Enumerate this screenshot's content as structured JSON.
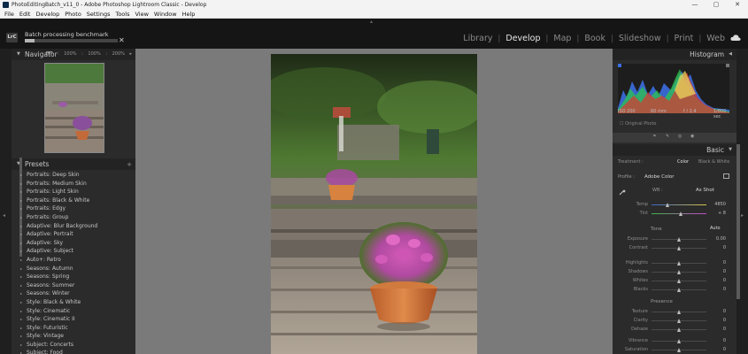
{
  "window": {
    "title": "PhotoEditingBatch_v11_0 - Adobe Photoshop Lightroom Classic - Develop",
    "controls": [
      "minimize-icon",
      "maximize-icon",
      "close-icon"
    ]
  },
  "menu": [
    "File",
    "Edit",
    "Develop",
    "Photo",
    "Settings",
    "Tools",
    "View",
    "Window",
    "Help"
  ],
  "identity": {
    "badge": "LrC",
    "batch_label": "Batch processing benchmark",
    "progress": 0.1
  },
  "modules": [
    "Library",
    "Develop",
    "Map",
    "Book",
    "Slideshow",
    "Print",
    "Web"
  ],
  "active_module": "Develop",
  "navigator": {
    "title": "Navigator",
    "zoom": [
      "FIT",
      "100%",
      "100%",
      "200%"
    ]
  },
  "presets": {
    "title": "Presets",
    "items": [
      "Portraits: Deep Skin",
      "Portraits: Medium Skin",
      "Portraits: Light Skin",
      "Portraits: Black & White",
      "Portraits: Edgy",
      "Portraits: Group",
      "Adaptive: Blur Background",
      "Adaptive: Portrait",
      "Adaptive: Sky",
      "Adaptive: Subject",
      "Auto+: Retro",
      "Seasons: Autumn",
      "Seasons: Spring",
      "Seasons: Summer",
      "Seasons: Winter",
      "Style: Black & White",
      "Style: Cinematic",
      "Style: Cinematic II",
      "Style: Futuristic",
      "Style: Vintage",
      "Subject: Concerts",
      "Subject: Food"
    ]
  },
  "histogram": {
    "title": "Histogram",
    "info": [
      "ISO 200",
      "60 mm",
      "f / 2.4",
      "1/800 sec"
    ],
    "original_photo": "Original Photo"
  },
  "basic": {
    "title": "Basic",
    "treatment_label": "Treatment :",
    "treatment_options": [
      "Color",
      "Black & White"
    ],
    "profile_label": "Profile :",
    "profile_value": "Adobe Color",
    "wb_label": "WB :",
    "wb_value": "As Shot",
    "temp": {
      "label": "Temp",
      "value": "4850"
    },
    "tint": {
      "label": "Tint",
      "value": "+ 8"
    },
    "tone_label": "Tone",
    "auto_label": "Auto",
    "tone_sliders": [
      {
        "label": "Exposure",
        "value": "0.00"
      },
      {
        "label": "Contrast",
        "value": "0"
      },
      {
        "label": "Highlights",
        "value": "0"
      },
      {
        "label": "Shadows",
        "value": "0"
      },
      {
        "label": "Whites",
        "value": "0"
      },
      {
        "label": "Blacks",
        "value": "0"
      }
    ],
    "presence_label": "Presence",
    "presence_sliders": [
      {
        "label": "Texture",
        "value": "0"
      },
      {
        "label": "Clarity",
        "value": "0"
      },
      {
        "label": "Dehaze",
        "value": "0"
      },
      {
        "label": "Vibrance",
        "value": "0"
      },
      {
        "label": "Saturation",
        "value": "0"
      }
    ]
  }
}
